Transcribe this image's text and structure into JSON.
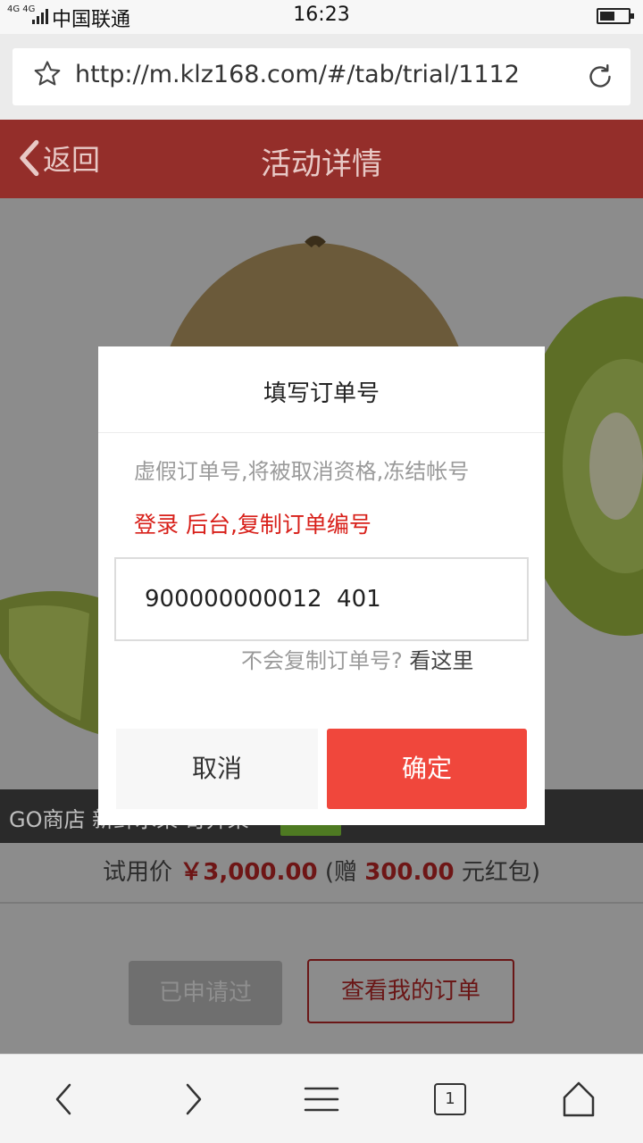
{
  "status_bar": {
    "network": "4G 4G",
    "carrier": "中国联通",
    "time": "16:23"
  },
  "browser": {
    "url": "http://m.klz168.com/#/tab/trial/1112",
    "bookmark_icon": "star-icon",
    "reload_icon": "reload-icon"
  },
  "header": {
    "back_label": "返回",
    "title": "活动详情"
  },
  "product": {
    "shop_text": "GO商店 新鲜水果 奇异果",
    "price_label": "试用价",
    "price": "￥3,000.00",
    "gift_prefix": "(赠",
    "gift_amount": "300.00",
    "gift_suffix": "元红包)"
  },
  "actions": {
    "applied_label": "已申请过",
    "orders_label": "查看我的订单"
  },
  "dialog": {
    "title": "填写订单号",
    "warning": "虚假订单号,将被取消资格,冻结帐号",
    "hint": "登录 后台,复制订单编号",
    "order_value": "900000000012  401",
    "help_text": "不会复制订单号?",
    "help_link": "看这里",
    "cancel_label": "取消",
    "confirm_label": "确定"
  },
  "bottom_nav": {
    "tab_count": "1"
  },
  "colors": {
    "header_red": "#942e2a",
    "confirm_red": "#f0473c",
    "hint_red": "#d8201a"
  }
}
